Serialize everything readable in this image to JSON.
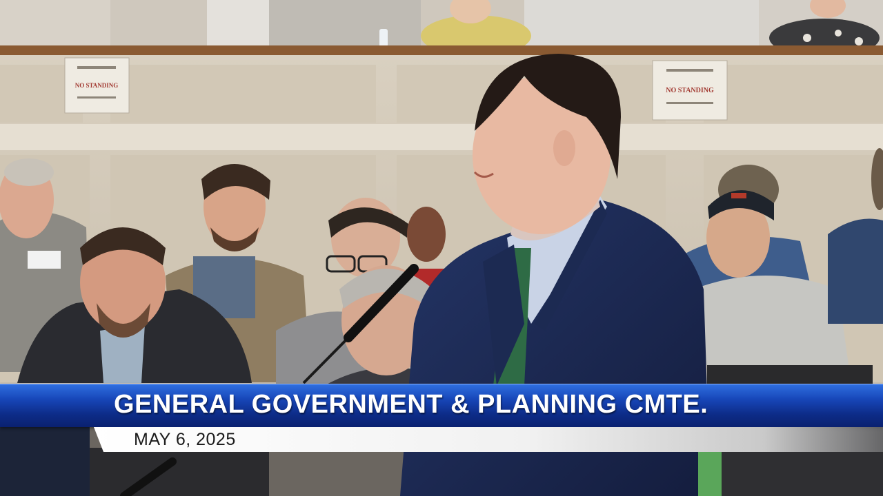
{
  "chyron": {
    "title": "GENERAL GOVERNMENT & PLANNING CMTE.",
    "date": "MAY 6, 2025"
  },
  "signs": {
    "left": "NO STANDING",
    "right": "NO STANDING"
  },
  "colors": {
    "chyron_blue": "#1746b8",
    "chyron_text": "#ffffff",
    "date_text": "#1a1a1a",
    "suit_navy": "#1c2a52",
    "tie_green": "#2e6b45"
  }
}
